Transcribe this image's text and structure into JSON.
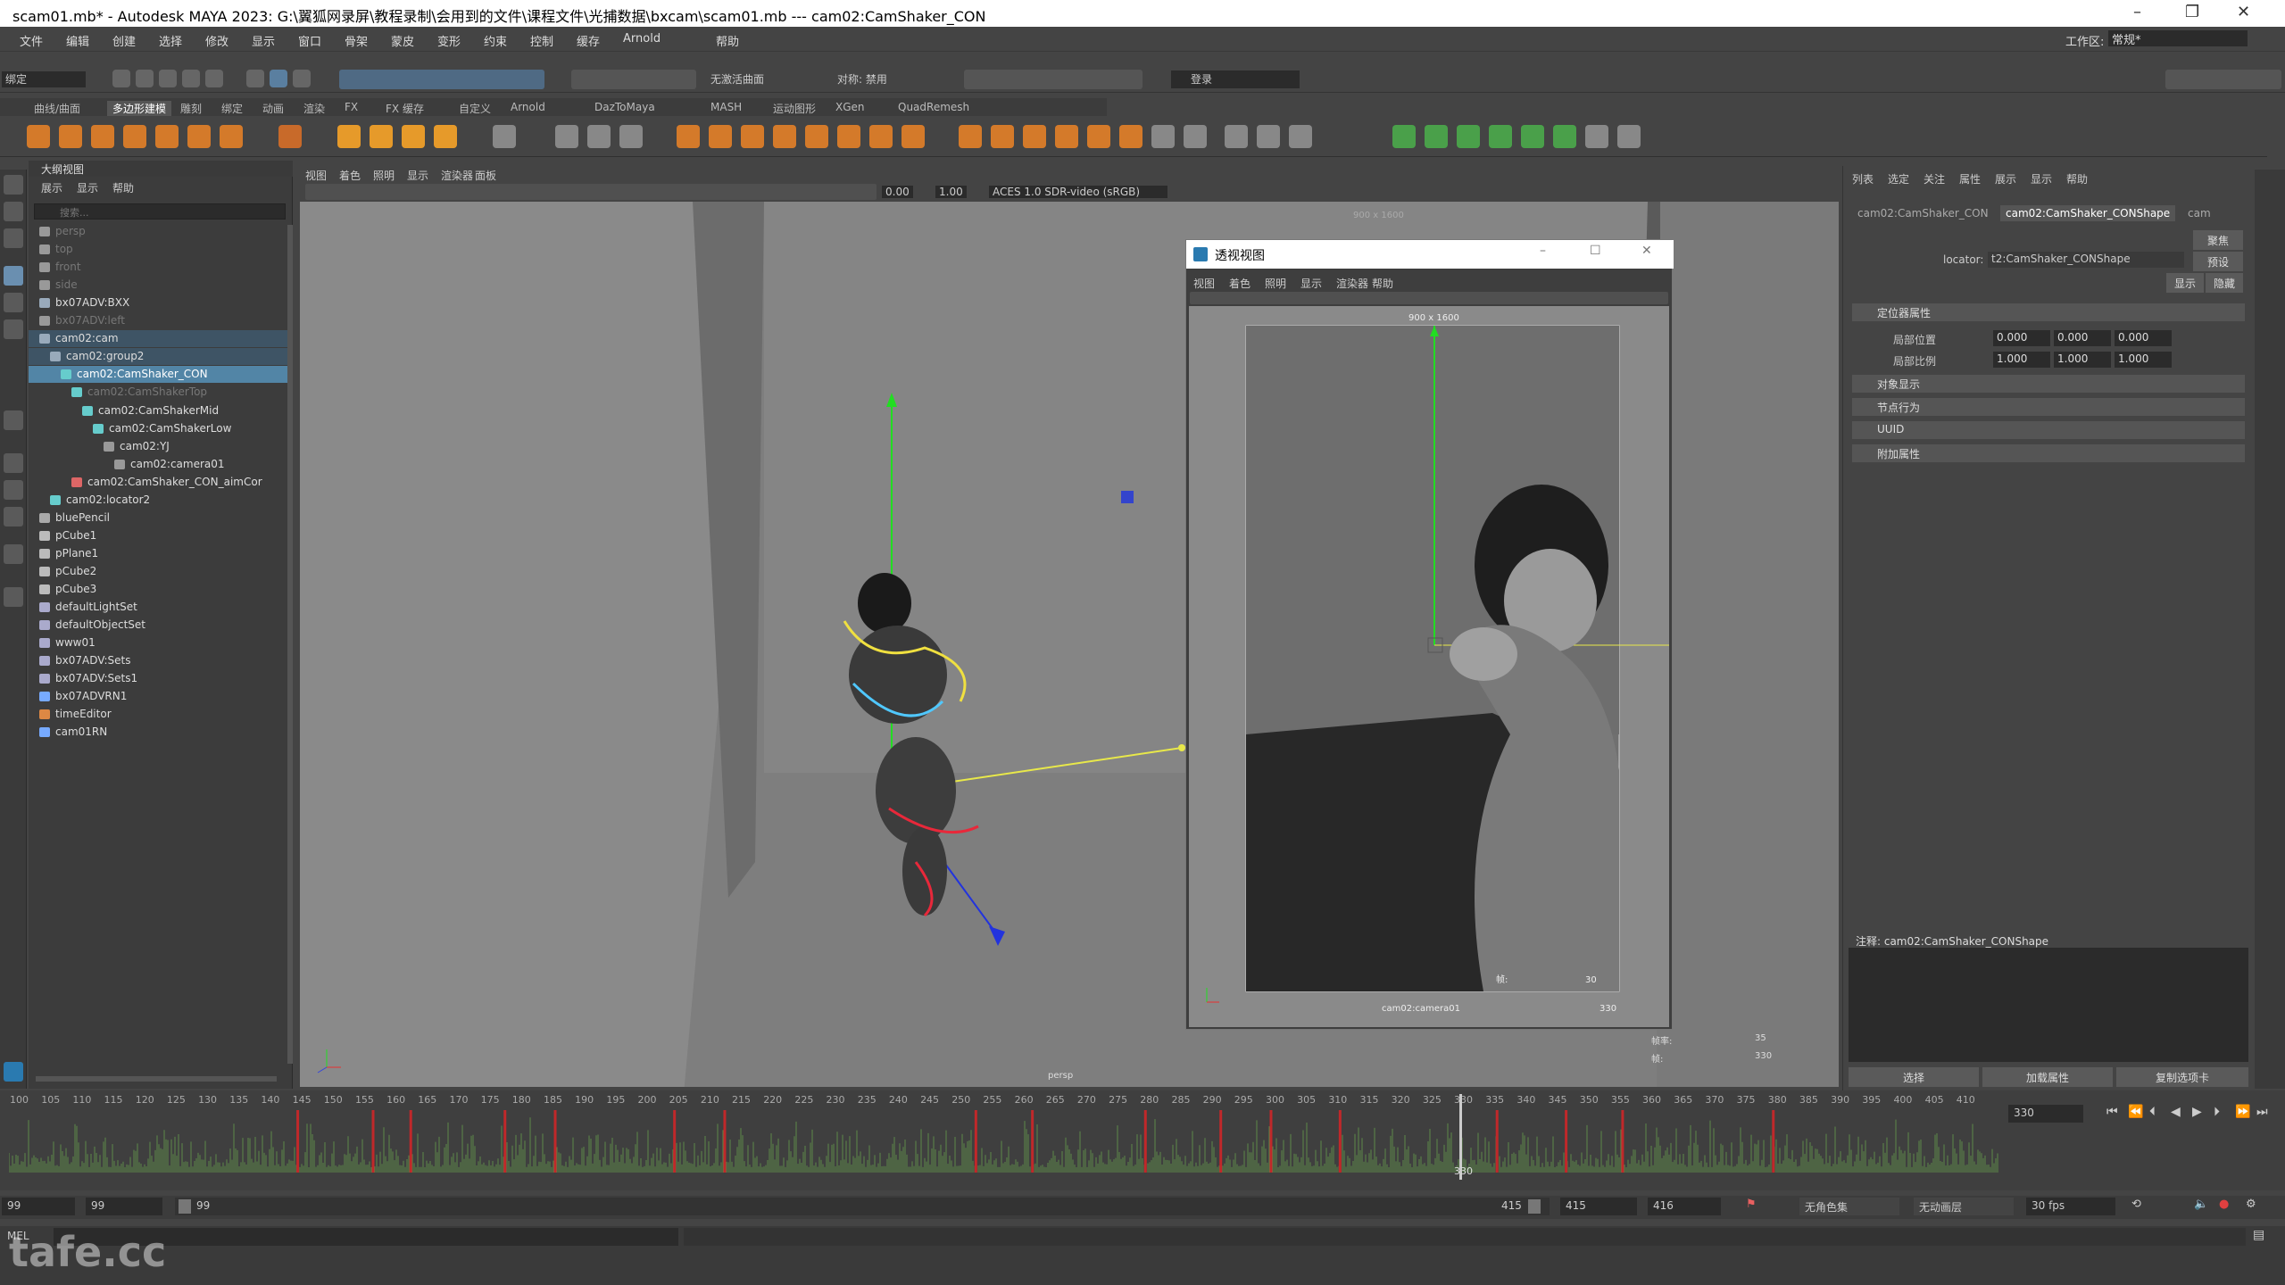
{
  "title_bar": {
    "title": "scam01.mb* - Autodesk MAYA 2023: G:\\翼狐网录屏\\教程录制\\会用到的文件\\课程文件\\光捕数据\\bxcam\\scam01.mb  ---  cam02:CamShaker_CON",
    "min": "–",
    "max": "❐",
    "close": "✕"
  },
  "menu": {
    "items": [
      "文件",
      "编辑",
      "创建",
      "选择",
      "修改",
      "显示",
      "窗口",
      "骨架",
      "蒙皮",
      "变形",
      "约束",
      "控制",
      "缓存",
      "Arnold",
      "帮助"
    ],
    "workspace_label": "工作区:",
    "workspace_value": "常规*"
  },
  "status_line": {
    "mode": "绑定",
    "live_surface": "无激活曲面",
    "symmetry": "对称: 禁用",
    "login": "登录"
  },
  "shelf_tabs": [
    "曲线/曲面",
    "多边形建模",
    "雕刻",
    "绑定",
    "动画",
    "渲染",
    "FX",
    "FX 缓存",
    "自定义",
    "Arnold",
    "DazToMaya",
    "MASH",
    "运动图形",
    "XGen",
    "QuadRemesh"
  ],
  "shelf_active": 1,
  "outliner": {
    "title": "大纲视图",
    "menu": [
      "展示",
      "显示",
      "帮助"
    ],
    "search_placeholder": "搜索...",
    "rows": [
      {
        "label": "persp",
        "indent": 0,
        "dim": true,
        "icon": "camera-icon"
      },
      {
        "label": "top",
        "indent": 0,
        "dim": true,
        "icon": "camera-icon"
      },
      {
        "label": "front",
        "indent": 0,
        "dim": true,
        "icon": "camera-icon"
      },
      {
        "label": "side",
        "indent": 0,
        "dim": true,
        "icon": "camera-icon"
      },
      {
        "label": "bx07ADV:BXX",
        "indent": 0,
        "dim": false,
        "icon": "group-icon"
      },
      {
        "label": "bx07ADV:left",
        "indent": 0,
        "dim": true,
        "icon": "camera-icon"
      },
      {
        "label": "cam02:cam",
        "indent": 0,
        "dim": false,
        "icon": "group-icon",
        "state": "par"
      },
      {
        "label": "cam02:group2",
        "indent": 1,
        "dim": false,
        "icon": "group-icon",
        "state": "par"
      },
      {
        "label": "cam02:CamShaker_CON",
        "indent": 2,
        "dim": false,
        "icon": "locator-icon",
        "state": "sel"
      },
      {
        "label": "cam02:CamShakerTop",
        "indent": 3,
        "dim": true,
        "icon": "locator-icon"
      },
      {
        "label": "cam02:CamShakerMid",
        "indent": 4,
        "dim": false,
        "icon": "locator-icon"
      },
      {
        "label": "cam02:CamShakerLow",
        "indent": 5,
        "dim": false,
        "icon": "locator-icon"
      },
      {
        "label": "cam02:YJ",
        "indent": 6,
        "dim": false,
        "icon": "camera-icon"
      },
      {
        "label": "cam02:camera01",
        "indent": 7,
        "dim": false,
        "icon": "camera-icon"
      },
      {
        "label": "cam02:CamShaker_CON_aimCor",
        "indent": 3,
        "dim": false,
        "icon": "constraint-icon"
      },
      {
        "label": "cam02:locator2",
        "indent": 1,
        "dim": false,
        "icon": "locator-icon"
      },
      {
        "label": "bluePencil",
        "indent": 0,
        "dim": false,
        "icon": "pencil-icon"
      },
      {
        "label": "pCube1",
        "indent": 0,
        "dim": false,
        "icon": "mesh-icon"
      },
      {
        "label": "pPlane1",
        "indent": 0,
        "dim": false,
        "icon": "mesh-icon"
      },
      {
        "label": "pCube2",
        "indent": 0,
        "dim": false,
        "icon": "mesh-icon"
      },
      {
        "label": "pCube3",
        "indent": 0,
        "dim": false,
        "icon": "mesh-icon"
      },
      {
        "label": "defaultLightSet",
        "indent": 0,
        "dim": false,
        "icon": "set-icon"
      },
      {
        "label": "defaultObjectSet",
        "indent": 0,
        "dim": false,
        "icon": "set-icon"
      },
      {
        "label": "www01",
        "indent": 0,
        "dim": false,
        "icon": "set-icon"
      },
      {
        "label": "bx07ADV:Sets",
        "indent": 0,
        "dim": false,
        "icon": "set-icon"
      },
      {
        "label": "bx07ADV:Sets1",
        "indent": 0,
        "dim": false,
        "icon": "set-icon"
      },
      {
        "label": "bx07ADVRN1",
        "indent": 0,
        "dim": false,
        "icon": "reference-icon"
      },
      {
        "label": "timeEditor",
        "indent": 0,
        "dim": false,
        "icon": "editor-icon"
      },
      {
        "label": "cam01RN",
        "indent": 0,
        "dim": false,
        "icon": "reference-icon"
      }
    ]
  },
  "viewport": {
    "menu": [
      "视图",
      "着色",
      "照明",
      "显示",
      "渲染器",
      "面板"
    ],
    "exposure": "0.00",
    "gamma": "1.00",
    "color_space": "ACES 1.0 SDR-video (sRGB)",
    "resolution_gate": "900 x 1600",
    "camera_name": "persp",
    "hud_labels": [
      "帧率:",
      "帧:"
    ],
    "hud_values": [
      "35",
      "330"
    ]
  },
  "float_window": {
    "title": "透视视图",
    "menu": [
      "视图",
      "着色",
      "照明",
      "显示",
      "渲染器",
      "帮助"
    ],
    "resolution": "900 x 1600",
    "camera": "cam02:camera01",
    "frame_label": "帧:",
    "fps_value": "30",
    "frame_value": "330"
  },
  "attribute_editor": {
    "menu": [
      "列表",
      "选定",
      "关注",
      "属性",
      "展示",
      "显示",
      "帮助"
    ],
    "tabs": [
      "cam02:CamShaker_CON",
      "cam02:CamShaker_CONShape",
      "cam"
    ],
    "active_tab": 1,
    "locator_label": "locator:",
    "locator_value": "t2:CamShaker_CONShape",
    "buttons": [
      "聚焦",
      "预设",
      "显示",
      "隐藏"
    ],
    "section_locator": "定位器属性",
    "local_position_label": "局部位置",
    "local_position": [
      "0.000",
      "0.000",
      "0.000"
    ],
    "local_scale_label": "局部比例",
    "local_scale": [
      "1.000",
      "1.000",
      "1.000"
    ],
    "sections": [
      "对象显示",
      "节点行为",
      "UUID",
      "附加属性"
    ],
    "notes_label": "注释:  cam02:CamShaker_CONShape",
    "footer_buttons": [
      "选择",
      "加载属性",
      "复制选项卡"
    ]
  },
  "timeline": {
    "ticks": [
      "100",
      "105",
      "110",
      "115",
      "120",
      "125",
      "130",
      "135",
      "140",
      "145",
      "150",
      "155",
      "160",
      "165",
      "170",
      "175",
      "180",
      "185",
      "190",
      "195",
      "200",
      "205",
      "210",
      "215",
      "220",
      "225",
      "230",
      "235",
      "240",
      "245",
      "250",
      "255",
      "260",
      "265",
      "270",
      "275",
      "280",
      "285",
      "290",
      "295",
      "300",
      "305",
      "310",
      "315",
      "320",
      "325",
      "330",
      "335",
      "340",
      "345",
      "350",
      "355",
      "360",
      "365",
      "370",
      "375",
      "380",
      "385",
      "390",
      "395",
      "400",
      "405",
      "410"
    ],
    "current_frame": "330",
    "current_frame_field": "330"
  },
  "range": {
    "start": "99",
    "anim_start": "99",
    "slider_start": "99",
    "slider_end": "415",
    "anim_end": "415",
    "end": "416",
    "char_set": "无角色集",
    "anim_layer": "无动画层",
    "fps": "30 fps"
  },
  "command": {
    "lang": "MEL"
  },
  "watermark": "tafe.cc",
  "colors": {
    "selection": "#5285a6",
    "timeline_key": "#c0282a",
    "wave": "#5c8a4a",
    "y_axis": "#22dd22",
    "z_axis": "#2233dd",
    "aim_line": "#e8e84a"
  }
}
